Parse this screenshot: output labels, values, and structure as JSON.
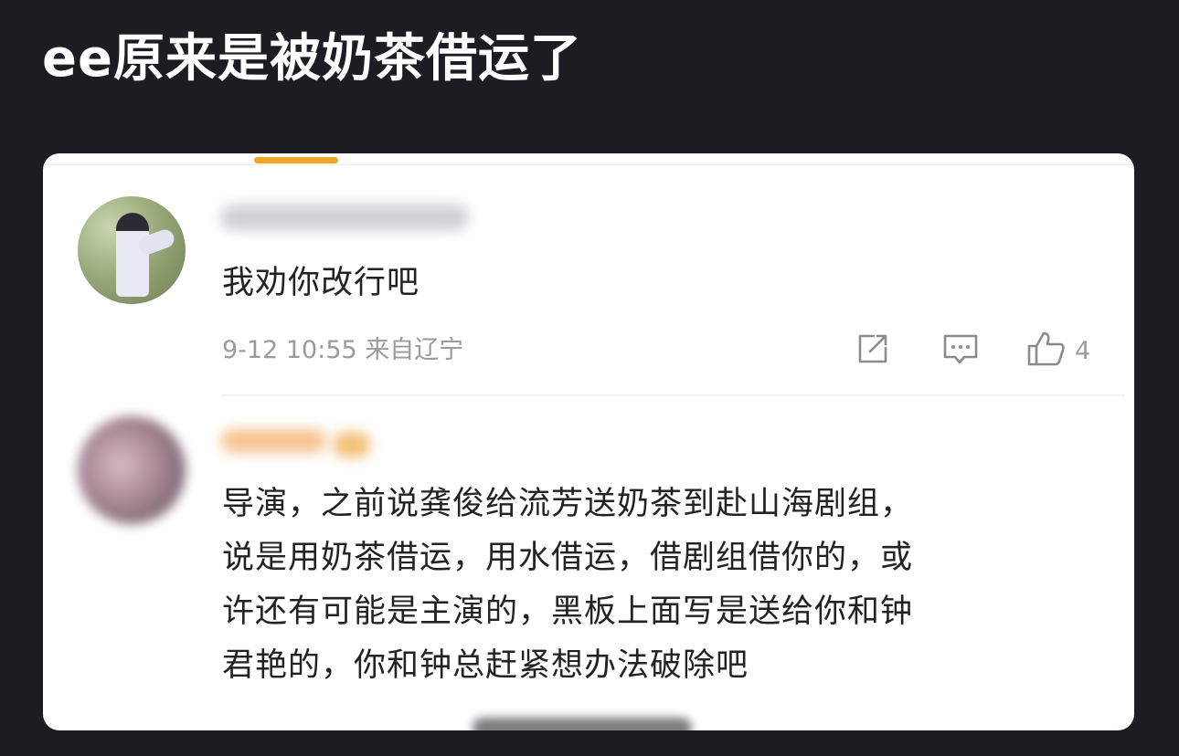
{
  "post": {
    "title": "ee原来是被奶茶借运了"
  },
  "comments": [
    {
      "text": "我劝你改行吧",
      "meta": "9-12 10:55 来自辽宁",
      "like_count": "4"
    },
    {
      "lines": [
        "导演，之前说龚俊给流芳送奶茶到赴山海剧组，",
        "说是用奶茶借运，用水借运，借剧组借你的，或",
        "许还有可能是主演的，黑板上面写是送给你和钟",
        "君艳的，你和钟总赶紧想办法破除吧"
      ]
    }
  ],
  "icons": {
    "share": "share-icon",
    "comment": "comment-icon",
    "like": "thumbs-up-icon"
  },
  "colors": {
    "background": "#1d1c22",
    "card": "#ffffff",
    "accent": "#f0a629",
    "text": "#222222",
    "meta": "#9a9aa0"
  }
}
